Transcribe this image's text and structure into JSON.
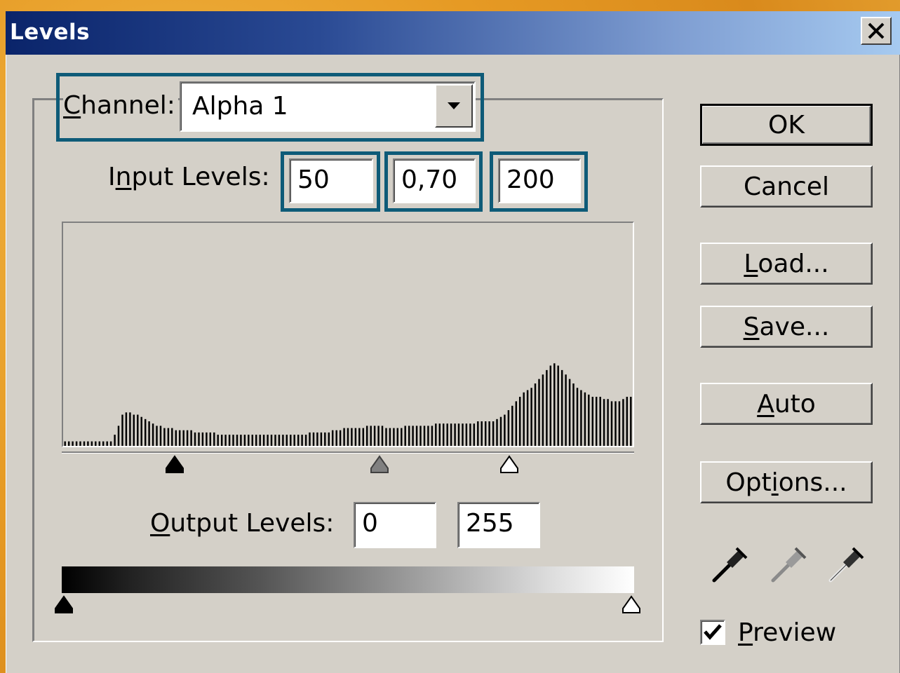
{
  "window": {
    "title": "Levels",
    "close_label": "×"
  },
  "channel": {
    "label": "Channel:",
    "label_mnemonic": "C",
    "label_rest": "hannel:",
    "value": "Alpha 1"
  },
  "input_levels": {
    "label_pre": "I",
    "label_mnemonic": "n",
    "label_rest": "put Levels:",
    "black": "50",
    "gamma": "0,70",
    "white": "200"
  },
  "output_levels": {
    "label_mnemonic": "O",
    "label_rest": "utput Levels:",
    "black": "0",
    "white": "255"
  },
  "buttons": {
    "ok": "OK",
    "cancel": "Cancel",
    "load_mnemonic": "L",
    "load_rest": "oad...",
    "save_mnemonic": "S",
    "save_rest": "ave...",
    "auto_mnemonic": "A",
    "auto_rest": "uto",
    "options_pre": "Opt",
    "options_mnemonic": "i",
    "options_rest": "ons..."
  },
  "preview": {
    "mnemonic": "P",
    "rest": "review",
    "checked": true
  },
  "eyedroppers": [
    "black-eyedropper-icon",
    "gray-eyedropper-icon",
    "white-eyedropper-icon"
  ],
  "colors": {
    "highlight_border": "#0e5b78",
    "dialog_bg": "#d4d0c8",
    "title_start": "#0a246a",
    "title_end": "#a6caf0"
  },
  "histogram": {
    "levels": [
      0.02,
      0.02,
      0.02,
      0.02,
      0.02,
      0.02,
      0.02,
      0.02,
      0.02,
      0.02,
      0.02,
      0.02,
      0.02,
      0.05,
      0.09,
      0.14,
      0.15,
      0.15,
      0.14,
      0.14,
      0.13,
      0.12,
      0.11,
      0.1,
      0.09,
      0.09,
      0.08,
      0.08,
      0.08,
      0.07,
      0.07,
      0.07,
      0.07,
      0.07,
      0.06,
      0.06,
      0.06,
      0.06,
      0.06,
      0.06,
      0.05,
      0.05,
      0.05,
      0.05,
      0.05,
      0.05,
      0.05,
      0.05,
      0.05,
      0.05,
      0.05,
      0.05,
      0.05,
      0.05,
      0.05,
      0.05,
      0.05,
      0.05,
      0.05,
      0.05,
      0.05,
      0.05,
      0.05,
      0.05,
      0.06,
      0.06,
      0.06,
      0.06,
      0.06,
      0.06,
      0.07,
      0.07,
      0.07,
      0.08,
      0.08,
      0.08,
      0.08,
      0.08,
      0.08,
      0.09,
      0.09,
      0.09,
      0.09,
      0.09,
      0.08,
      0.08,
      0.08,
      0.08,
      0.08,
      0.09,
      0.09,
      0.09,
      0.09,
      0.09,
      0.09,
      0.09,
      0.09,
      0.1,
      0.1,
      0.1,
      0.1,
      0.1,
      0.1,
      0.1,
      0.1,
      0.1,
      0.1,
      0.1,
      0.11,
      0.11,
      0.11,
      0.11,
      0.11,
      0.12,
      0.13,
      0.14,
      0.16,
      0.18,
      0.2,
      0.22,
      0.24,
      0.25,
      0.26,
      0.28,
      0.3,
      0.32,
      0.34,
      0.36,
      0.37,
      0.36,
      0.34,
      0.32,
      0.3,
      0.28,
      0.26,
      0.25,
      0.24,
      0.23,
      0.22,
      0.22,
      0.22,
      0.21,
      0.21,
      0.2,
      0.2,
      0.2,
      0.21,
      0.22,
      0.22
    ]
  }
}
